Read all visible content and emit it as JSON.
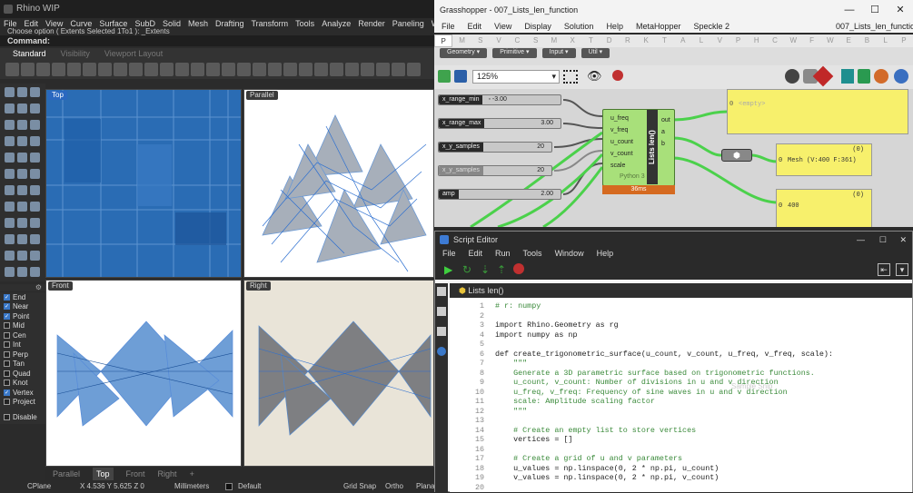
{
  "rhino": {
    "title": "Rhino WIP",
    "menu": [
      "File",
      "Edit",
      "View",
      "Curve",
      "Surface",
      "SubD",
      "Solid",
      "Mesh",
      "Drafting",
      "Transform",
      "Tools",
      "Analyze",
      "Render",
      "Paneling Tools",
      "Window",
      "He"
    ],
    "cmd_history": "Choose option ( Extents  Selected  1To1 ): _Extents",
    "cmd_prompt": "Command:",
    "toolbar_tabs": [
      "Standard",
      "Visibility",
      "Viewport Layout"
    ],
    "viewports": {
      "top": "Top",
      "parallel": "Parallel",
      "front": "Front",
      "right": "Right"
    },
    "osnaps": [
      {
        "label": "End",
        "on": true
      },
      {
        "label": "Near",
        "on": true
      },
      {
        "label": "Point",
        "on": true
      },
      {
        "label": "Mid",
        "on": false
      },
      {
        "label": "Cen",
        "on": false
      },
      {
        "label": "Int",
        "on": false
      },
      {
        "label": "Perp",
        "on": false
      },
      {
        "label": "Tan",
        "on": false
      },
      {
        "label": "Quad",
        "on": false
      },
      {
        "label": "Knot",
        "on": false
      },
      {
        "label": "Vertex",
        "on": true
      },
      {
        "label": "Project",
        "on": false
      }
    ],
    "disable_label": "Disable",
    "viewport_tabs": [
      "Parallel",
      "Top",
      "Front",
      "Right",
      "+"
    ],
    "status": {
      "cplane": "CPlane",
      "coords": "X 4.536  Y 5.625  Z 0",
      "units": "Millimeters",
      "layer": "Default",
      "grid_snap": "Grid Snap",
      "ortho": "Ortho",
      "planar": "Plana"
    }
  },
  "gh": {
    "title": "Grasshopper - 007_Lists_len_function",
    "menu": [
      "File",
      "Edit",
      "View",
      "Display",
      "Solution",
      "Help",
      "MetaHopper",
      "Speckle 2"
    ],
    "doc_name": "007_Lists_len_function",
    "tabs": [
      "P",
      "M",
      "S",
      "V",
      "C",
      "S",
      "M",
      "X",
      "T",
      "D",
      "R",
      "K",
      "T",
      "A",
      "L",
      "V",
      "P",
      "H",
      "C",
      "W",
      "F",
      "W",
      "E",
      "B",
      "L",
      "P"
    ],
    "subtabs": [
      "Geometry",
      "Primitive",
      "Input",
      "Util"
    ],
    "zoom": "125%",
    "sliders": [
      {
        "name": "x_range_min",
        "value": "-3.00"
      },
      {
        "name": "x_range_max",
        "value": "3.00"
      },
      {
        "name": "x_y_samples",
        "value": "20"
      },
      {
        "name": "x_y_samples",
        "value": "20"
      },
      {
        "name": "amp",
        "value": "2.00"
      }
    ],
    "component": {
      "inputs": [
        "u_freq",
        "v_freq",
        "u_count",
        "v_count",
        "scale"
      ],
      "outputs": [
        "out",
        "a",
        "b"
      ],
      "name": "Lists len()",
      "subtitle": "Python 3",
      "time": "36ms"
    },
    "panels": {
      "out_index": "0",
      "out_text": "<empty>",
      "mesh_count": "(0)",
      "mesh_index": "0",
      "mesh_text": "Mesh (V:400  F:361)",
      "len_count": "(0)",
      "len_index": "0",
      "len_text": "400"
    }
  },
  "editor": {
    "title": "Script Editor",
    "menu": [
      "File",
      "Edit",
      "Run",
      "Tools",
      "Window",
      "Help"
    ],
    "tab": "Lists len()",
    "ghost": "Sample Snip",
    "lines": [
      {
        "n": "1",
        "t": "# r: numpy",
        "c": "cm"
      },
      {
        "n": "2",
        "t": "",
        "c": ""
      },
      {
        "n": "3",
        "t": "import Rhino.Geometry as rg",
        "c": ""
      },
      {
        "n": "4",
        "t": "import numpy as np",
        "c": ""
      },
      {
        "n": "5",
        "t": "",
        "c": ""
      },
      {
        "n": "6",
        "t": "def create_trigonometric_surface(u_count, v_count, u_freq, v_freq, scale):",
        "c": ""
      },
      {
        "n": "7",
        "t": "    \"\"\"",
        "c": "cm"
      },
      {
        "n": "8",
        "t": "    Generate a 3D parametric surface based on trigonometric functions.",
        "c": "cm"
      },
      {
        "n": "9",
        "t": "    u_count, v_count: Number of divisions in u and v direction",
        "c": "cm"
      },
      {
        "n": "10",
        "t": "    u_freq, v_freq: Frequency of sine waves in u and v direction",
        "c": "cm"
      },
      {
        "n": "11",
        "t": "    scale: Amplitude scaling factor",
        "c": "cm"
      },
      {
        "n": "12",
        "t": "    \"\"\"",
        "c": "cm"
      },
      {
        "n": "13",
        "t": "",
        "c": ""
      },
      {
        "n": "14",
        "t": "    # Create an empty list to store vertices",
        "c": "cm"
      },
      {
        "n": "15",
        "t": "    vertices = []",
        "c": ""
      },
      {
        "n": "16",
        "t": "",
        "c": ""
      },
      {
        "n": "17",
        "t": "    # Create a grid of u and v parameters",
        "c": "cm"
      },
      {
        "n": "18",
        "t": "    u_values = np.linspace(0, 2 * np.pi, u_count)",
        "c": ""
      },
      {
        "n": "19",
        "t": "    v_values = np.linspace(0, 2 * np.pi, v_count)",
        "c": ""
      },
      {
        "n": "20",
        "t": "",
        "c": ""
      }
    ]
  }
}
